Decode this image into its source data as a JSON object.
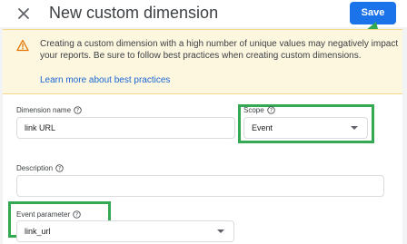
{
  "dialog": {
    "title": "New custom dimension",
    "save_label": "Save"
  },
  "icons": {
    "close": "close-icon",
    "warning": "warning-icon",
    "help": "help-circle-icon",
    "dropdown": "dropdown-arrow-icon"
  },
  "warning": {
    "message": "Creating a custom dimension with a high number of unique values may negatively impact your reports. Be sure to follow best practices when creating custom dimensions.",
    "link_text": "Learn more about best practices"
  },
  "form": {
    "dimension_name": {
      "label": "Dimension name",
      "value": "link URL"
    },
    "scope": {
      "label": "Scope",
      "value": "Event"
    },
    "description": {
      "label": "Description",
      "value": ""
    },
    "event_parameter": {
      "label": "Event parameter",
      "value": "link_url"
    }
  },
  "colors": {
    "accent": "#1a73e8",
    "highlight": "#34a853",
    "warning_bg": "#fef7e0",
    "warning_icon": "#e37400",
    "link": "#1967d2"
  }
}
